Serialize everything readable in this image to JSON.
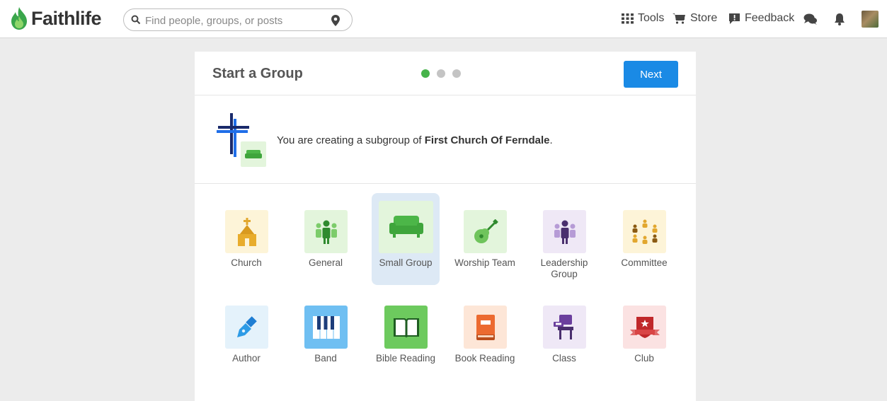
{
  "app": {
    "name": "Faithlife"
  },
  "search": {
    "placeholder": "Find people, groups, or posts"
  },
  "nav": {
    "tools_label": "Tools",
    "store_label": "Store",
    "feedback_label": "Feedback"
  },
  "wizard": {
    "title": "Start a Group",
    "steps_total": 3,
    "current_step": 1,
    "next_label": "Next"
  },
  "subgroup": {
    "prefix": "You are creating a subgroup of ",
    "parent": "First Church Of Ferndale",
    "suffix": "."
  },
  "group_types": [
    {
      "label": "Church",
      "icon": "church-icon",
      "color": "#fdf4d8"
    },
    {
      "label": "General",
      "icon": "people-group-icon",
      "color": "#e3f5dc"
    },
    {
      "label": "Small Group",
      "icon": "couch-icon",
      "color": "#e3f5dc",
      "selected": true
    },
    {
      "label": "Worship Team",
      "icon": "guitar-icon",
      "color": "#e3f5dc"
    },
    {
      "label": "Leadership Group",
      "icon": "leadership-icon",
      "color": "#efe8f6"
    },
    {
      "label": "Committee",
      "icon": "committee-icon",
      "color": "#fdf4d8"
    },
    {
      "label": "Author",
      "icon": "pen-nib-icon",
      "color": "#e4f2fb"
    },
    {
      "label": "Band",
      "icon": "piano-keys-icon",
      "color": "#6fbff2"
    },
    {
      "label": "Bible Reading",
      "icon": "open-book-icon",
      "color": "#6dca5e"
    },
    {
      "label": "Book Reading",
      "icon": "book-icon",
      "color": "#fde6d7"
    },
    {
      "label": "Class",
      "icon": "desk-chair-icon",
      "color": "#efe8f6"
    },
    {
      "label": "Club",
      "icon": "club-badge-icon",
      "color": "#fbe2e2"
    }
  ],
  "colors": {
    "brand_green": "#46b34a",
    "primary_blue": "#1a8ae5"
  }
}
